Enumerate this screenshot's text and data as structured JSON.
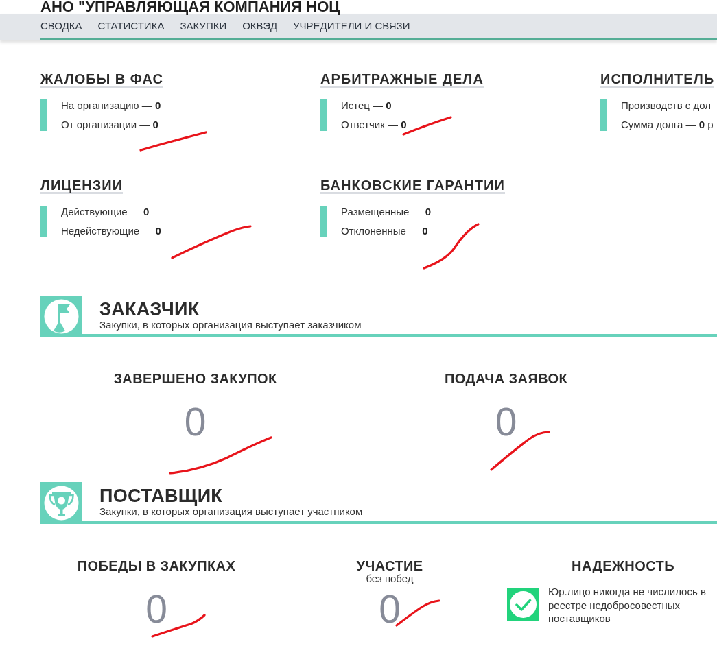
{
  "company_title": "АНО \"УПРАВЛЯЮЩАЯ КОМПАНИЯ НОЦ",
  "nav": [
    "СВОДКА",
    "СТАТИСТИКА",
    "ЗАКУПКИ",
    "ОКВЭД",
    "УЧРЕДИТЕЛИ И СВЯЗИ"
  ],
  "info_blocks": [
    {
      "title": "ЖАЛОБЫ В ФАС",
      "items": [
        "На организацию — **0**",
        "От организации — **0**"
      ]
    },
    {
      "title": "АРБИТРАЖНЫЕ ДЕЛА",
      "items": [
        "Истец — **0**",
        "Ответчик — **0**"
      ]
    },
    {
      "title": "ИСПОЛНИТЕЛЬ",
      "items": [
        "Производств с дол",
        "Сумма долга — **0** р"
      ]
    },
    {
      "title": "ЛИЦЕНЗИИ",
      "items": [
        "Действующие — **0**",
        "Недействующие — **0**"
      ]
    },
    {
      "title": "БАНКОВСКИЕ ГАРАНТИИ",
      "items": [
        "Размещенные — **0**",
        "Отклоненные — **0**"
      ]
    }
  ],
  "customer": {
    "title": "ЗАКАЗЧИК",
    "subtitle": "Закупки, в которых организация выступает заказчиком",
    "stats": [
      {
        "kind": "count",
        "title": "ЗАВЕРШЕНО ЗАКУПОК",
        "value": "0"
      },
      {
        "kind": "count",
        "title": "ПОДАЧА ЗАЯВОК",
        "value": "0"
      }
    ]
  },
  "supplier": {
    "title": "ПОСТАВЩИК",
    "subtitle": "Закупки, в которых организация выступает участником",
    "stats": [
      {
        "kind": "count",
        "title": "ПОБЕДЫ В ЗАКУПКАХ",
        "value": "0"
      },
      {
        "kind": "count",
        "title": "УЧАСТИЕ",
        "subtitle": "без побед",
        "value": "0"
      },
      {
        "kind": "reliability",
        "title": "НАДЕЖНОСТЬ",
        "passed": true,
        "text": "Юр.лицо никогда не числилось в реестре недобросовестных поставщиков"
      }
    ]
  }
}
